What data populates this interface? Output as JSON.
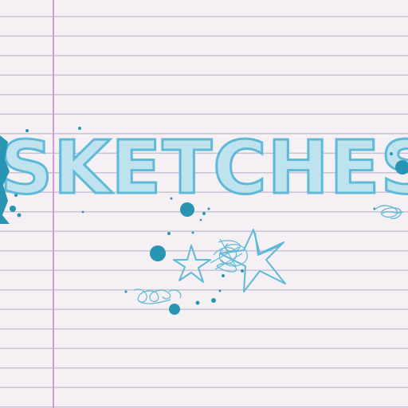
{
  "title": {
    "text": "SKETCHES"
  },
  "colors": {
    "paper": "#f4f0f4",
    "rule_line": "#c9c4d4",
    "margin_line": "#d79ad8",
    "ink": "#5fb9d8",
    "ink_dark": "#2a95b3"
  },
  "decorations": [
    "ink-splatter",
    "star-icon",
    "scribble"
  ]
}
